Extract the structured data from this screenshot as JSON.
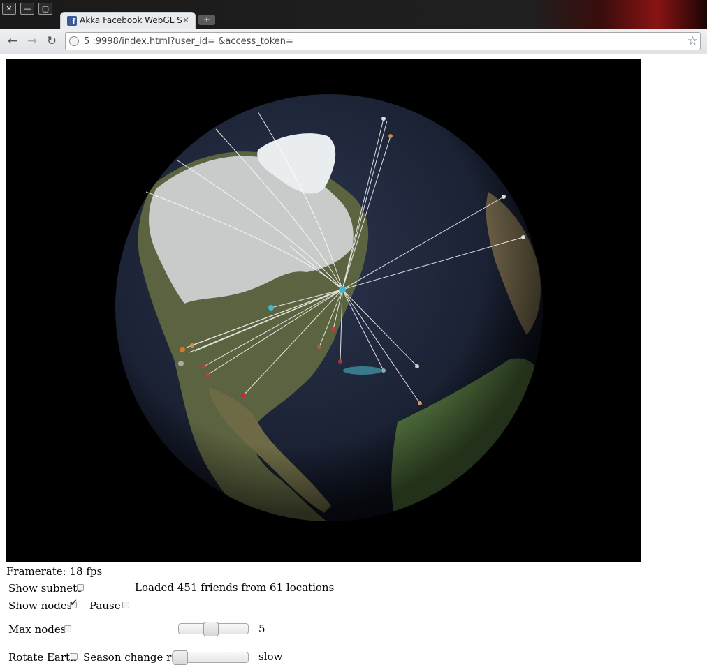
{
  "window": {
    "close_symbol": "✕",
    "minimize_symbol": "—",
    "maximize_symbol": "▢",
    "tab_title": "Akka Facebook WebGL S...",
    "tab_close_symbol": "✕",
    "new_tab_symbol": "+",
    "favicon_letter": "f",
    "favicon_color": "#3b5998"
  },
  "toolbar": {
    "back_symbol": "←",
    "forward_symbol": "→",
    "reload_symbol": "↻",
    "url": "5                        :9998/index.html?user_id=                                &access_token=",
    "bookmark_symbol": "☆"
  },
  "status": {
    "framerate": "Framerate: 18 fps",
    "loaded": "Loaded 451 friends from 61 locations"
  },
  "controls": {
    "show_subnets_label": "Show subnets",
    "show_subnets_checked": false,
    "show_nodes_label": "Show nodes",
    "show_nodes_checked": true,
    "pause_label": "Pause",
    "pause_checked": false,
    "max_nodes_label": "Max nodes",
    "max_nodes_checked": false,
    "max_nodes_value": "5",
    "max_nodes_slider_fraction": 0.45,
    "rotate_earth_label": "Rotate Earth",
    "rotate_earth_checked": false,
    "season_change_label": "Season change rate",
    "season_change_value": "slow",
    "season_slider_fraction": 0.0
  },
  "colors": {
    "ocean": "#1a2030",
    "land": "#4f5a3a",
    "snow": "#e8ecef",
    "connection_line": "#ffffff"
  }
}
